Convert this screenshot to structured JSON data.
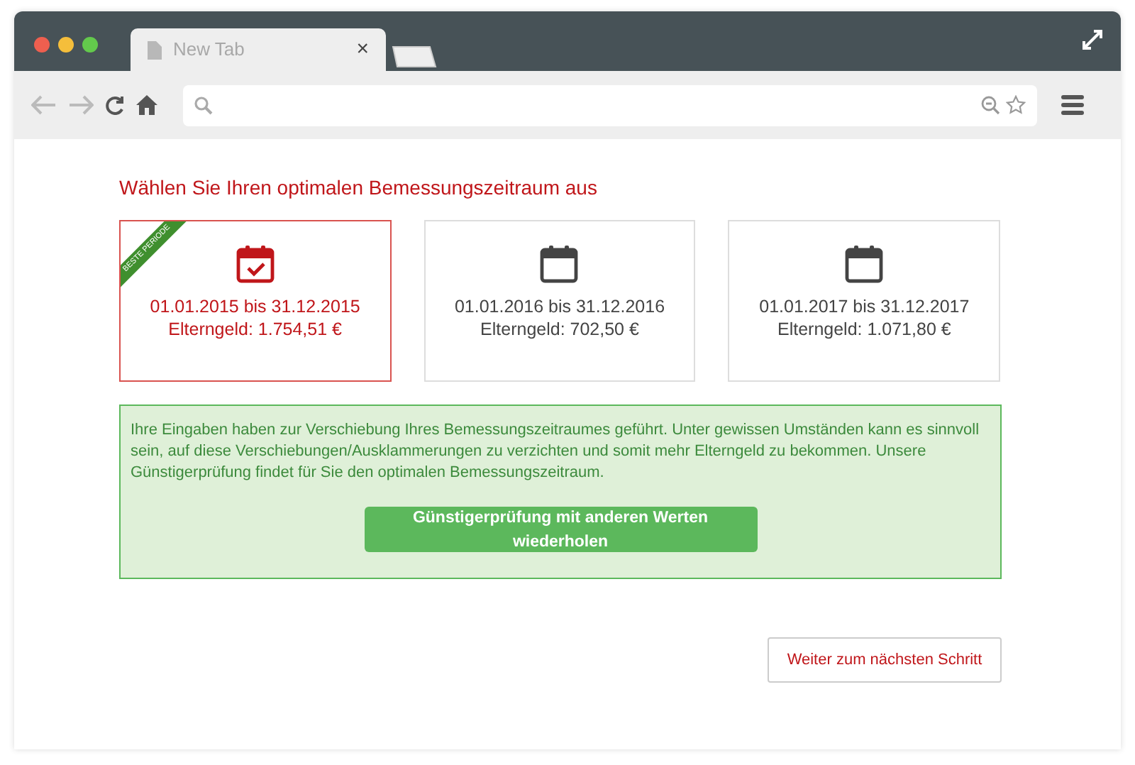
{
  "browser": {
    "tab_title": "New Tab",
    "close_glyph": "×"
  },
  "heading": "Wählen Sie Ihren optimalen Bemessungszeitraum aus",
  "periods": [
    {
      "range": "01.01.2015 bis 31.12.2015",
      "amount": "Elterngeld: 1.754,51 €",
      "selected": true,
      "ribbon": "BESTE PERIODE"
    },
    {
      "range": "01.01.2016 bis 31.12.2016",
      "amount": "Elterngeld: 702,50 €",
      "selected": false
    },
    {
      "range": "01.01.2017 bis 31.12.2017",
      "amount": "Elterngeld: 1.071,80 €",
      "selected": false
    }
  ],
  "notice": {
    "text": "Ihre Eingaben haben zur Verschiebung Ihres Bemessungszeitraumes geführt. Unter gewissen Umständen kann es sinnvoll sein, auf diese Verschiebungen/Ausklammerungen zu verzichten und somit mehr Elterngeld zu bekommen. Unsere Günstigerprüfung findet für Sie den optimalen Bemessungszeitraum.",
    "button": "Günstigerprüfung mit anderen Werten wiederholen"
  },
  "next_button": "Weiter zum nächsten Schritt"
}
